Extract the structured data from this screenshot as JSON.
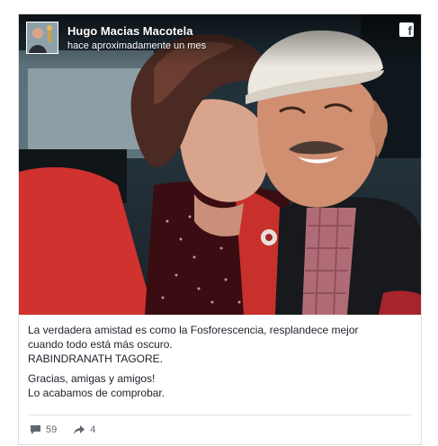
{
  "post": {
    "author": "Hugo Macias Macotela",
    "timestamp": "hace aproximadamente un mes",
    "caption_lines": [
      "La verdadera amistad es como la Fosforescencia, resplandece mejor",
      "cuando todo está más oscuro.",
      "RABINDRANATH TAGORE."
    ],
    "message_lines": [
      "Gracias, amigas y amigos!",
      "Lo acabamos de comprobar."
    ],
    "comments_count": "59",
    "shares_count": "4"
  },
  "icons": {
    "brand": "facebook-icon",
    "comments": "comment-icon",
    "shares": "share-arrow-icon"
  },
  "colors": {
    "header_text": "#ffffff",
    "body_text": "#1d2129",
    "meta_text": "#606770",
    "card_border": "#dddfe2"
  }
}
